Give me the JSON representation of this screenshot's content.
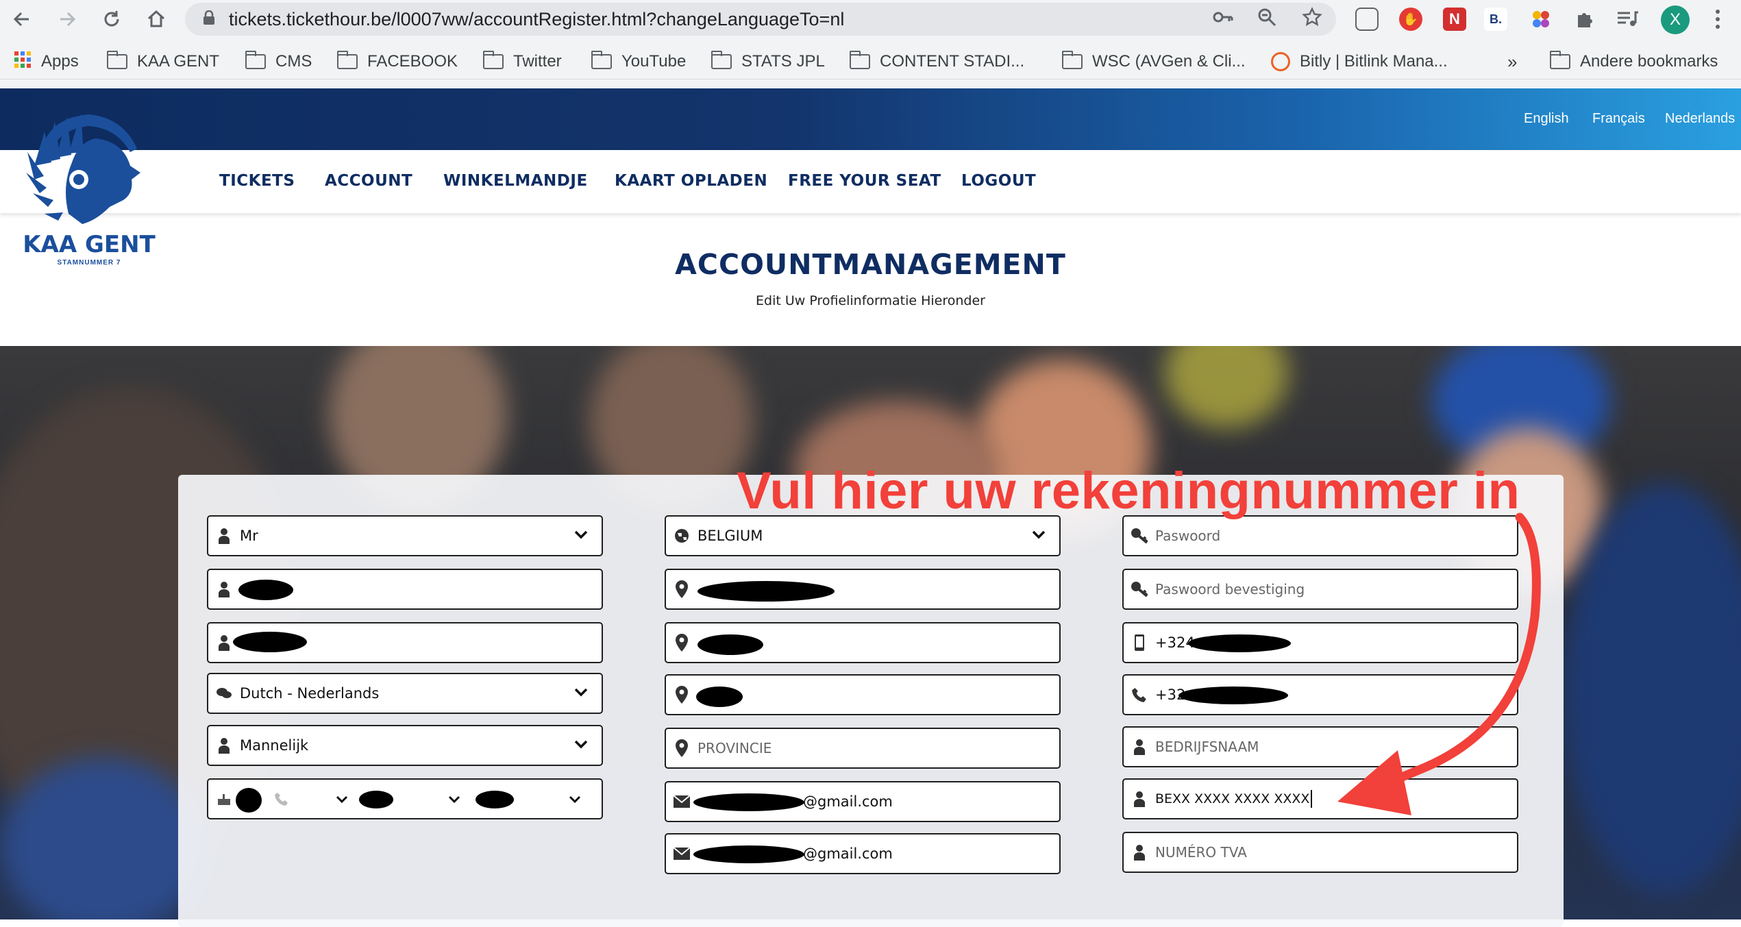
{
  "browser": {
    "url": "tickets.tickethour.be/l0007ww/accountRegister.html?changeLanguageTo=nl",
    "profile_initial": "X",
    "bookmarks": [
      "Apps",
      "KAA GENT",
      "CMS",
      "FACEBOOK",
      "Twitter",
      "YouTube",
      "STATS JPL",
      "CONTENT STADI...",
      "WSC (AVGen & Cli...",
      "Bitly | Bitlink Mana...",
      "Andere bookmarks"
    ],
    "overflow": "»"
  },
  "site": {
    "languages": [
      "English",
      "Français",
      "Nederlands"
    ],
    "logo_text": "KAA GENT",
    "logo_sub": "STAMNUMMER 7",
    "nav": [
      "TICKETS",
      "ACCOUNT",
      "WINKELMANDJE",
      "KAART OPLADEN",
      "FREE YOUR SEAT",
      "LOGOUT"
    ]
  },
  "page": {
    "title": "ACCOUNTMANAGEMENT",
    "subtitle": "Edit Uw Profielinformatie Hieronder"
  },
  "form": {
    "col1": {
      "salutation": "Mr",
      "language": "Dutch - Nederlands",
      "gender": "Mannelijk"
    },
    "col2": {
      "country": "BELGIUM",
      "province_placeholder": "PROVINCIE",
      "email_suffix": "@gmail.com",
      "email_confirm_suffix": "@gmail.com"
    },
    "col3": {
      "password_placeholder": "Paswoord",
      "password_confirm_placeholder": "Paswoord bevestiging",
      "mobile_prefix": "+324",
      "phone_prefix": "+32",
      "company_placeholder": "BEDRIJFSNAAM",
      "iban_value": "BEXX XXXX XXXX XXXX",
      "vat_placeholder": "NUMÉRO TVA"
    }
  },
  "annotation": {
    "text": "Vul hier uw rekeningnummer in",
    "color": "#f2403a"
  }
}
